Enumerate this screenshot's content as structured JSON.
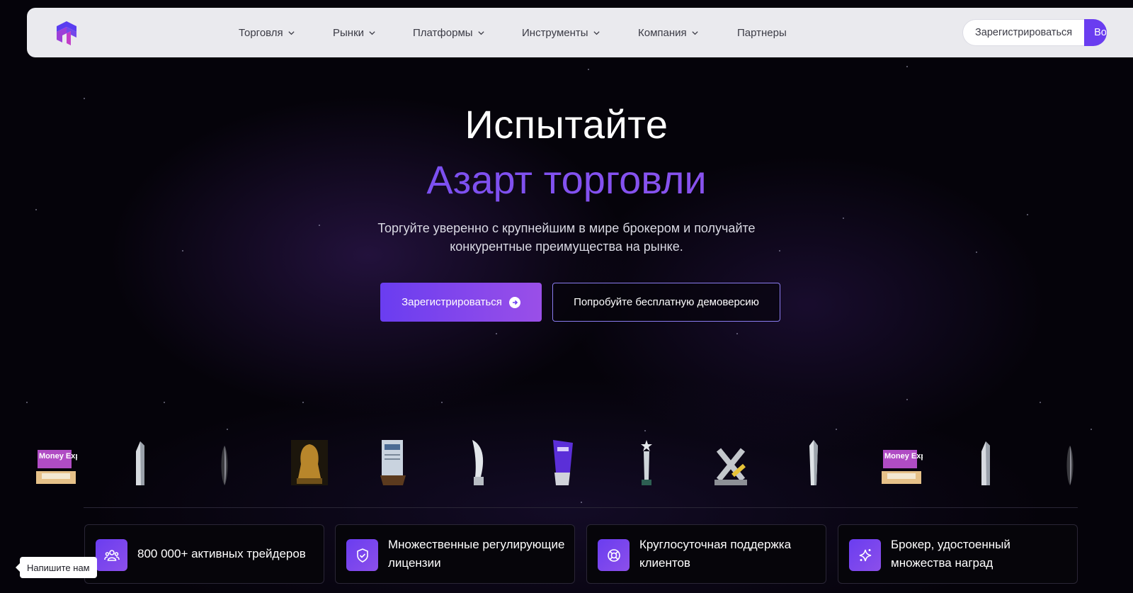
{
  "nav": {
    "logo_icon": "brand-logo-icon",
    "items": [
      {
        "label": "Торговля",
        "has_dropdown": true
      },
      {
        "label": "Рынки",
        "has_dropdown": true
      },
      {
        "label": "Платформы",
        "has_dropdown": true
      },
      {
        "label": "Инструменты",
        "has_dropdown": true
      },
      {
        "label": "Компания",
        "has_dropdown": true
      },
      {
        "label": "Партнеры",
        "has_dropdown": false
      }
    ],
    "register_label": "Зарегистрироваться",
    "login_label": "Во"
  },
  "hero": {
    "title_line1": "Испытайте",
    "title_line2": "Азарт торговли",
    "subtitle_line1": "Торгуйте уверенно с крупнейшим в мире брокером и получайте",
    "subtitle_line2": "конкурентные преимущества на рынке.",
    "primary_button": "Зарегистрироваться",
    "secondary_button": "Попробуйте бесплатную демоверсию"
  },
  "awards": [
    {
      "name": "money-expo-award",
      "label": "Money Expo"
    },
    {
      "name": "crystal-trophy-award"
    },
    {
      "name": "dark-crystal-award"
    },
    {
      "name": "golden-pharaoh-award"
    },
    {
      "name": "plaque-award"
    },
    {
      "name": "glass-flame-award"
    },
    {
      "name": "purple-trophy-award"
    },
    {
      "name": "star-trophy-award"
    },
    {
      "name": "x-award"
    },
    {
      "name": "obelisk-award"
    },
    {
      "name": "money-expo-award",
      "label": "Money Expo"
    },
    {
      "name": "crystal-trophy-award"
    },
    {
      "name": "dark-crystal-award"
    }
  ],
  "features": [
    {
      "icon": "users-icon",
      "text": "800 000+ активных трейдеров"
    },
    {
      "icon": "shield-icon",
      "text": "Множественные регулирующие лицензии"
    },
    {
      "icon": "support-lifebuoy-icon",
      "text": "Круглосуточная поддержка клиентов"
    },
    {
      "icon": "sparkle-icon",
      "text": "Брокер, удостоенный множества наград"
    }
  ],
  "chat": {
    "label": "Напишите нам"
  },
  "colors": {
    "accent": "#6a3df0",
    "accent_end": "#9a4fe8",
    "background": "#05030a",
    "navbar_bg": "#eaeaee"
  }
}
